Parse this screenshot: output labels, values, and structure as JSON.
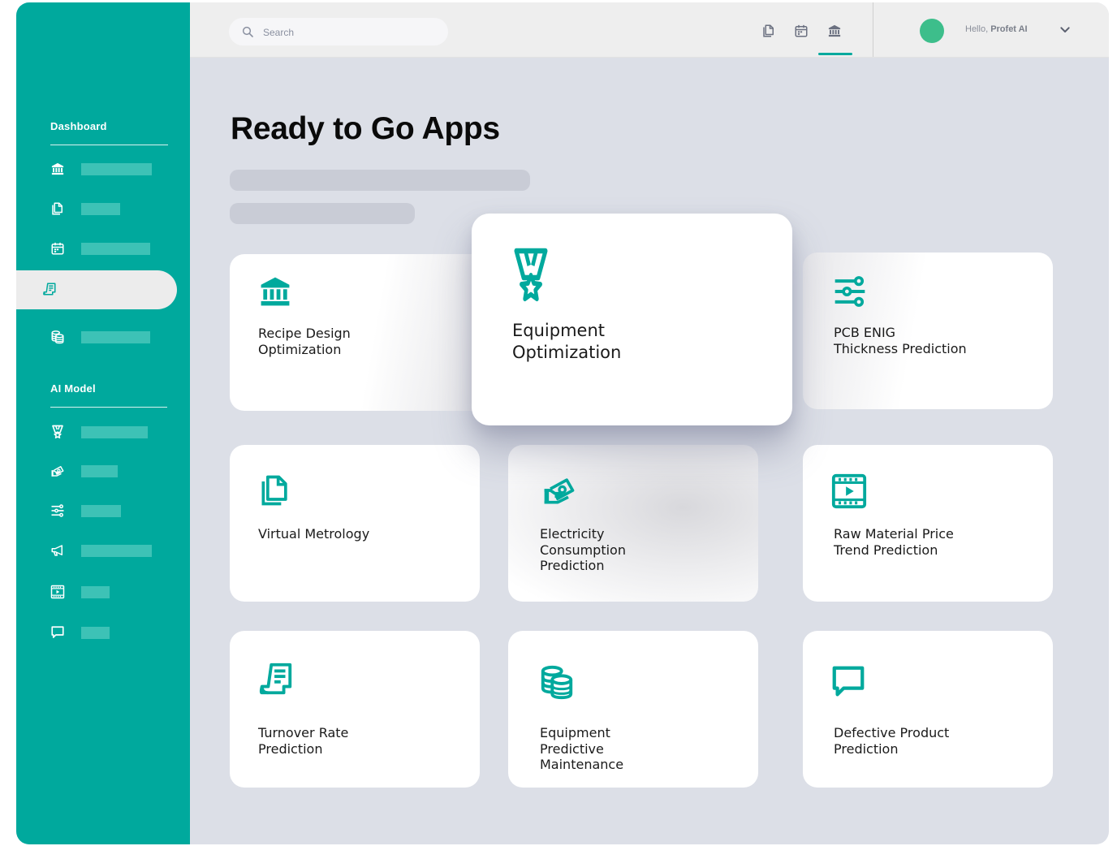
{
  "sidebar": {
    "sections": [
      {
        "title": "Dashboard"
      },
      {
        "title": "AI Model"
      }
    ],
    "dashboard_items": [
      {
        "icon": "bank-icon"
      },
      {
        "icon": "documents-icon"
      },
      {
        "icon": "calendar-icon"
      },
      {
        "icon": "receipt-icon",
        "active": true
      },
      {
        "icon": "coins-icon"
      }
    ],
    "model_items": [
      {
        "icon": "medal-icon"
      },
      {
        "icon": "money-hand-icon"
      },
      {
        "icon": "sliders-icon"
      },
      {
        "icon": "megaphone-icon"
      },
      {
        "icon": "video-icon"
      },
      {
        "icon": "chat-icon"
      }
    ]
  },
  "topbar": {
    "search_placeholder": "Search",
    "greeting_prefix": "Hello,",
    "user_name": "Profet AI",
    "icons": [
      "documents-icon",
      "calendar-icon",
      "bank-icon"
    ],
    "active_icon": "bank-icon"
  },
  "main": {
    "title": "Ready to Go Apps",
    "apps": [
      {
        "label": "Recipe Design\nOptimization",
        "icon": "bank-icon"
      },
      {
        "label": "Equipment\nOptimization",
        "icon": "medal-icon",
        "featured": true
      },
      {
        "label": "PCB ENIG\nThickness Prediction",
        "icon": "sliders-icon"
      },
      {
        "label": "Virtual Metrology",
        "icon": "documents-icon"
      },
      {
        "label": "Electricity\nConsumption\nPrediction",
        "icon": "money-hand-icon"
      },
      {
        "label": "Raw Material Price\nTrend Prediction",
        "icon": "video-icon"
      },
      {
        "label": "Turnover Rate\nPrediction",
        "icon": "receipt-icon"
      },
      {
        "label": "Equipment\nPredictive\nMaintenance",
        "icon": "coins-icon"
      },
      {
        "label": "Defective Product\nPrediction",
        "icon": "chat-icon"
      }
    ]
  },
  "colors": {
    "brand": "#00a99d",
    "sidebar_bar": "#3dc2b6",
    "background": "#dcdfe7",
    "avatar": "#3dbe8b"
  }
}
